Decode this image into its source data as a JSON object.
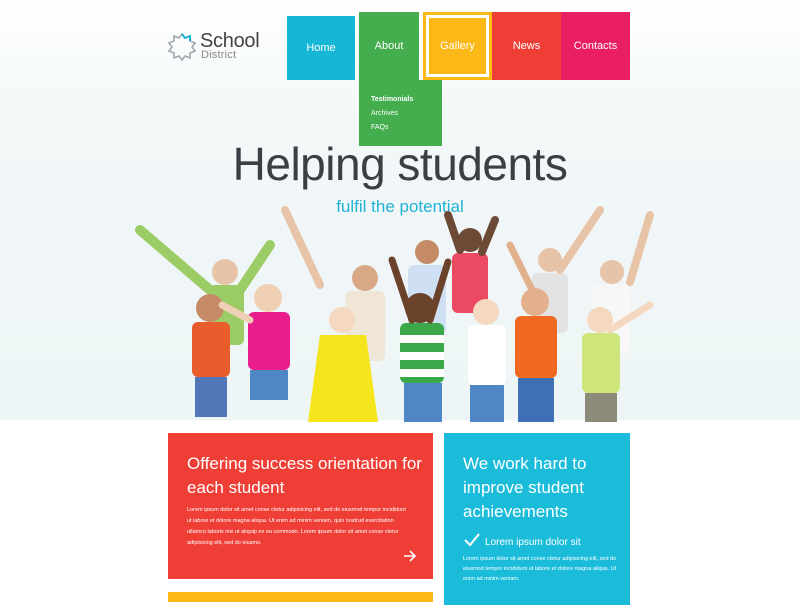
{
  "logo": {
    "title": "School",
    "subtitle": "District"
  },
  "nav": [
    {
      "label": "Home"
    },
    {
      "label": "About"
    },
    {
      "label": "Gallery"
    },
    {
      "label": "News"
    },
    {
      "label": "Contacts"
    }
  ],
  "submenu": [
    {
      "label": "Testimonials"
    },
    {
      "label": "Archives"
    },
    {
      "label": "FAQs"
    }
  ],
  "hero": {
    "title": "Helping students",
    "subtitle": "fulfil the potential"
  },
  "cards": {
    "red": {
      "title": "Offering success orientation for each student",
      "body": "Lorem ipsum dolor sit amet conse ctetur adipisicing elit, sed do eiusmod tempor incididunt ut labore et dolore magna aliqua. Ut enim ad minim veniam, quis nostrud exercitation ullamco laboris nisi ut aliquip ex ea commodo. Lorem ipsum dolor sit amet conse ctetur adipisicing elit, sed do eiusmo."
    },
    "blue": {
      "title": "We work hard to improve student achievements",
      "check_label": "Lorem ipsum dolor sit",
      "body": "Lorem ipsum dolor sit amet conse ctetur adipisicing elit, sed do eiusmod tempor incididunt ut labore et dolore magna aliqua. Ut enim ad minim veniam."
    }
  },
  "colors": {
    "home": "#16b6d6",
    "about": "#44ad4d",
    "gallery": "#fcb816",
    "news": "#ef3e36",
    "contacts": "#e91e63",
    "accent_text": "#21b3d4"
  }
}
